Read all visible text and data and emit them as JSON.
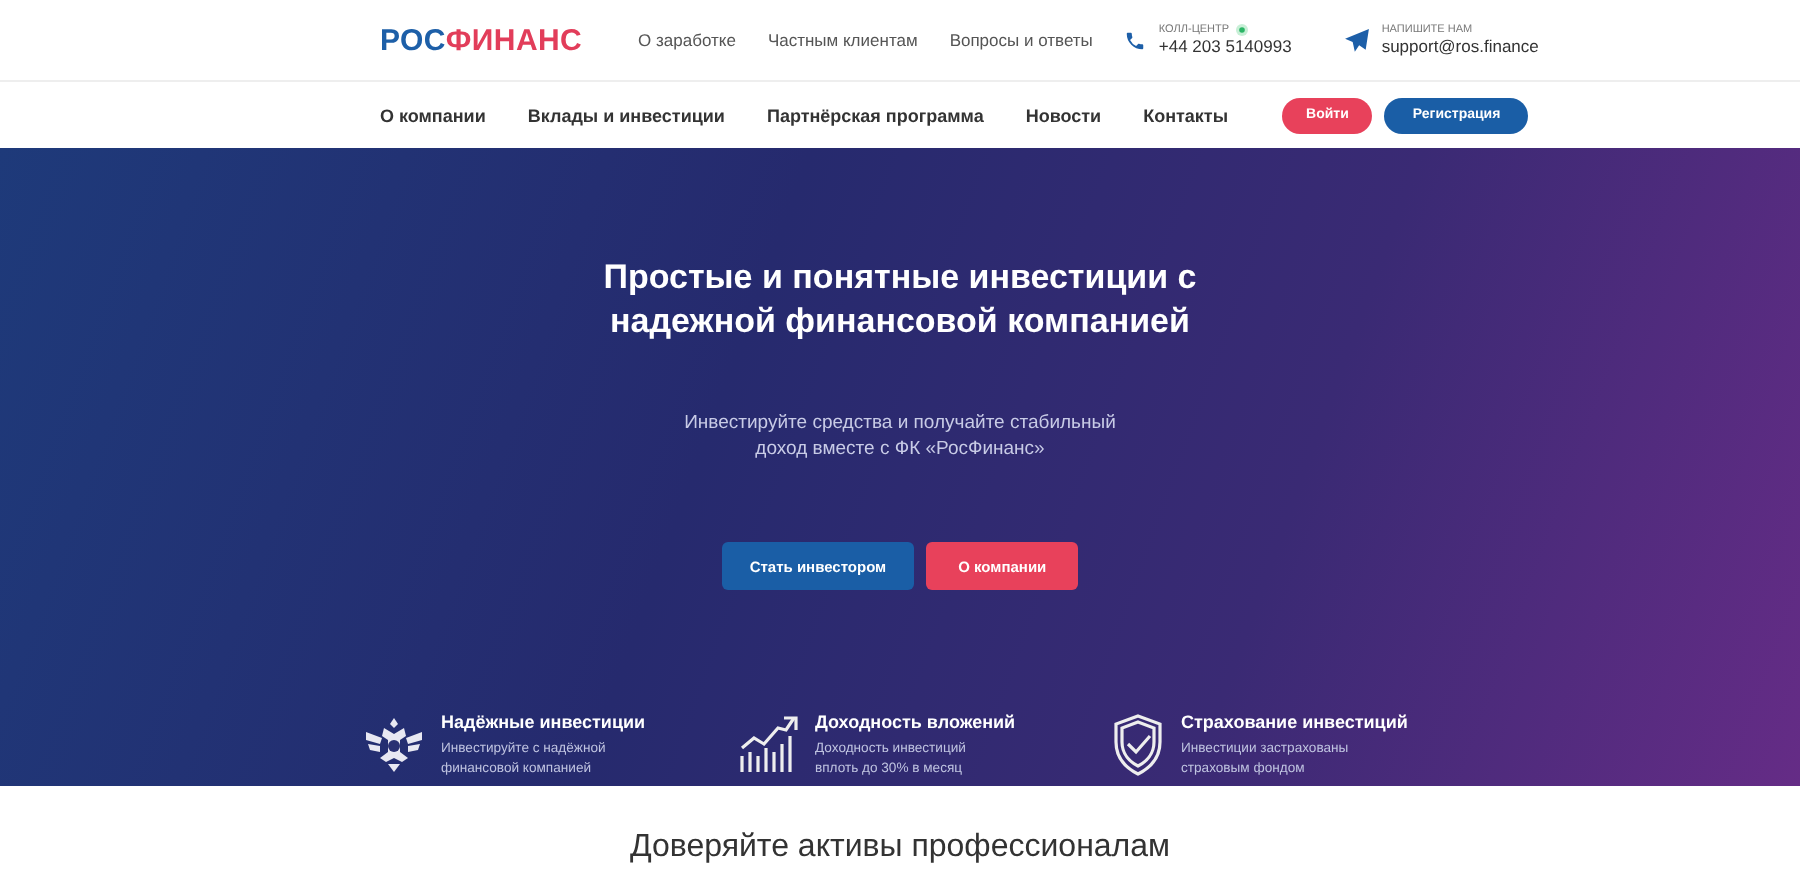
{
  "header": {
    "logo": {
      "first": "РОС",
      "second": "ФИНАНС"
    },
    "top_links": [
      "О заработке",
      "Частным клиентам",
      "Вопросы и ответы"
    ],
    "call_center": {
      "label": "КОЛЛ-ЦЕНТР",
      "phone": "+44 203 5140993"
    },
    "write_us": {
      "label": "НАПИШИТЕ НАМ",
      "email": "support@ros.finance"
    }
  },
  "nav": {
    "items": [
      "О компании",
      "Вклады и инвестиции",
      "Партнёрская программа",
      "Новости",
      "Контакты"
    ],
    "login": "Войти",
    "register": "Регистрация"
  },
  "hero": {
    "title": "Простые и понятные инвестиции с надежной финансовой компанией",
    "subtitle": "Инвестируйте средства и получайте стабильный доход вместе с ФК «РосФинанс»",
    "buttons": [
      {
        "label": "Стать инвестором",
        "kind": "primary"
      },
      {
        "label": "О компании",
        "kind": "accent"
      }
    ],
    "features": [
      {
        "kind": "emblem",
        "title": "Надёжные инвестиции",
        "text": "Инвестируйте с надёжной финансовой компанией"
      },
      {
        "kind": "growth",
        "title": "Доходность вложений",
        "text": "Доходность инвестиций вплоть до 30% в месяц"
      },
      {
        "kind": "shield",
        "title": "Страхование инвестиций",
        "text": "Инвестиции застрахованы страховым фондом"
      }
    ]
  },
  "section": {
    "title": "Доверяйте активы профессионалам"
  }
}
